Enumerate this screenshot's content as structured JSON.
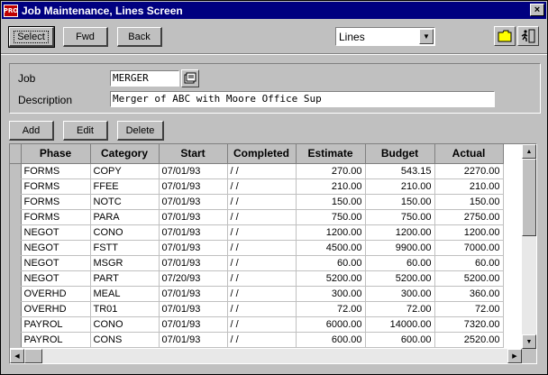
{
  "window": {
    "app_icon_text": "PRO",
    "title": "Job Maintenance, Lines Screen",
    "close_symbol": "×"
  },
  "toolbar": {
    "select_label": "Select",
    "fwd_label": "Fwd",
    "back_label": "Back",
    "view_select_value": "Lines",
    "icons": [
      "folder-icon",
      "exit-door-icon"
    ]
  },
  "form": {
    "job_label": "Job",
    "job_value": "MERGER",
    "description_label": "Description",
    "description_value": "Merger of ABC with Moore Office Sup"
  },
  "actions": {
    "add_label": "Add",
    "edit_label": "Edit",
    "delete_label": "Delete"
  },
  "grid": {
    "columns": [
      "Phase",
      "Category",
      "Start",
      "Completed",
      "Estimate",
      "Budget",
      "Actual"
    ],
    "rows": [
      [
        "FORMS",
        "COPY",
        "07/01/93",
        "/ /",
        "270.00",
        "543.15",
        "2270.00"
      ],
      [
        "FORMS",
        "FFEE",
        "07/01/93",
        "/ /",
        "210.00",
        "210.00",
        "210.00"
      ],
      [
        "FORMS",
        "NOTC",
        "07/01/93",
        "/ /",
        "150.00",
        "150.00",
        "150.00"
      ],
      [
        "FORMS",
        "PARA",
        "07/01/93",
        "/ /",
        "750.00",
        "750.00",
        "2750.00"
      ],
      [
        "NEGOT",
        "CONO",
        "07/01/93",
        "/ /",
        "1200.00",
        "1200.00",
        "1200.00"
      ],
      [
        "NEGOT",
        "FSTT",
        "07/01/93",
        "/ /",
        "4500.00",
        "9900.00",
        "7000.00"
      ],
      [
        "NEGOT",
        "MSGR",
        "07/01/93",
        "/ /",
        "60.00",
        "60.00",
        "60.00"
      ],
      [
        "NEGOT",
        "PART",
        "07/20/93",
        "/ /",
        "5200.00",
        "5200.00",
        "5200.00"
      ],
      [
        "OVERHD",
        "MEAL",
        "07/01/93",
        "/ /",
        "300.00",
        "300.00",
        "360.00"
      ],
      [
        "OVERHD",
        "TR01",
        "07/01/93",
        "/ /",
        "72.00",
        "72.00",
        "72.00"
      ],
      [
        "PAYROL",
        "CONO",
        "07/01/93",
        "/ /",
        "6000.00",
        "14000.00",
        "7320.00"
      ],
      [
        "PAYROL",
        "CONS",
        "07/01/93",
        "/ /",
        "600.00",
        "600.00",
        "2520.00"
      ]
    ]
  },
  "colors": {
    "titlebar": "#000080",
    "window_bg": "#c0c0c0",
    "app_icon": "#c00000"
  }
}
